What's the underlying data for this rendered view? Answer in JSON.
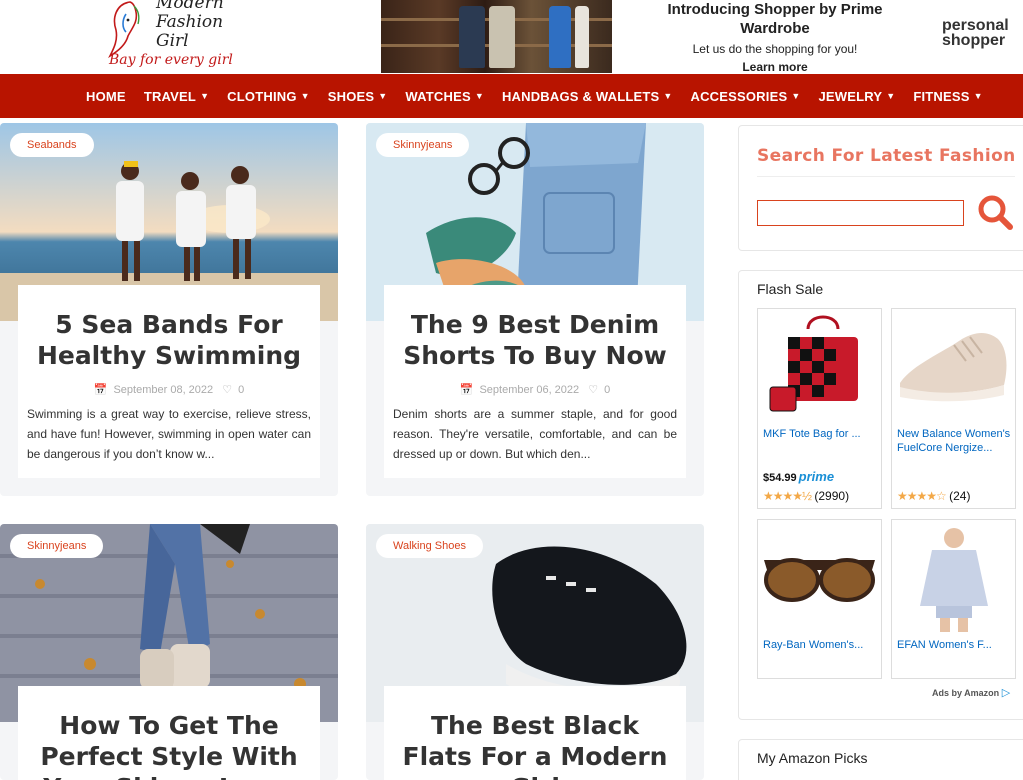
{
  "header": {
    "logo_line1": "Modern",
    "logo_line2": "Fashion",
    "logo_line3": "Girl",
    "logo_tagline": "Bay for every girl",
    "ad": {
      "title": "Introducing Shopper by Prime Wardrobe",
      "subtitle": "Let us do the shopping for you!",
      "cta": "Learn more",
      "brand_line1": "personal",
      "brand_line2": "shopper"
    }
  },
  "nav": {
    "items": [
      {
        "label": "HOME",
        "dropdown": false
      },
      {
        "label": "TRAVEL",
        "dropdown": true
      },
      {
        "label": "CLOTHING",
        "dropdown": true
      },
      {
        "label": "SHOES",
        "dropdown": true
      },
      {
        "label": "WATCHES",
        "dropdown": true
      },
      {
        "label": "HANDBAGS & WALLETS",
        "dropdown": true
      },
      {
        "label": "ACCESSORIES",
        "dropdown": true
      },
      {
        "label": "JEWELRY",
        "dropdown": true
      },
      {
        "label": "FITNESS",
        "dropdown": true
      }
    ]
  },
  "posts": [
    {
      "tag": "Seabands",
      "title": "5 Sea Bands For Healthy Swimming",
      "date": "September 08, 2022",
      "likes": "0",
      "excerpt": "Swimming is a great way to exercise, relieve stress, and have fun! However, swimming in open water can be dangerous if you don’t know w..."
    },
    {
      "tag": "Skinnyjeans",
      "title": "The 9 Best Denim Shorts To Buy Now",
      "date": "September 06, 2022",
      "likes": "0",
      "excerpt": "Denim shorts are a summer staple, and for good reason. They're versatile, comfortable, and can be dressed up or down. But which den..."
    },
    {
      "tag": "Skinnyjeans",
      "title": "How To Get The Perfect Style With Your Skinny Jeans"
    },
    {
      "tag": "Walking Shoes",
      "title": "The Best Black Flats For a Modern Girl"
    }
  ],
  "sidebar": {
    "search": {
      "title": "Search For Latest Fashion",
      "placeholder": ""
    },
    "flash_sale": {
      "title": "Flash Sale",
      "products": [
        {
          "name": "MKF Tote Bag for ...",
          "price": "$54.99",
          "prime": "prime",
          "stars": "★★★★½",
          "reviews": "(2990)"
        },
        {
          "name": "New Balance Women's FuelCore Nergize...",
          "price": "",
          "prime": "",
          "stars": "★★★★☆",
          "reviews": "(24)"
        },
        {
          "name": "Ray-Ban Women's...",
          "price": "",
          "prime": "",
          "stars": "",
          "reviews": ""
        },
        {
          "name": "EFAN Women's F...",
          "price": "",
          "prime": "",
          "stars": "",
          "reviews": ""
        }
      ],
      "ads_by": "Ads by Amazon"
    },
    "picks": {
      "title": "My Amazon Picks"
    }
  },
  "colors": {
    "nav_bg": "#b81400",
    "accent": "#d9431e",
    "search_title": "#e87560",
    "link": "#0066c0"
  }
}
